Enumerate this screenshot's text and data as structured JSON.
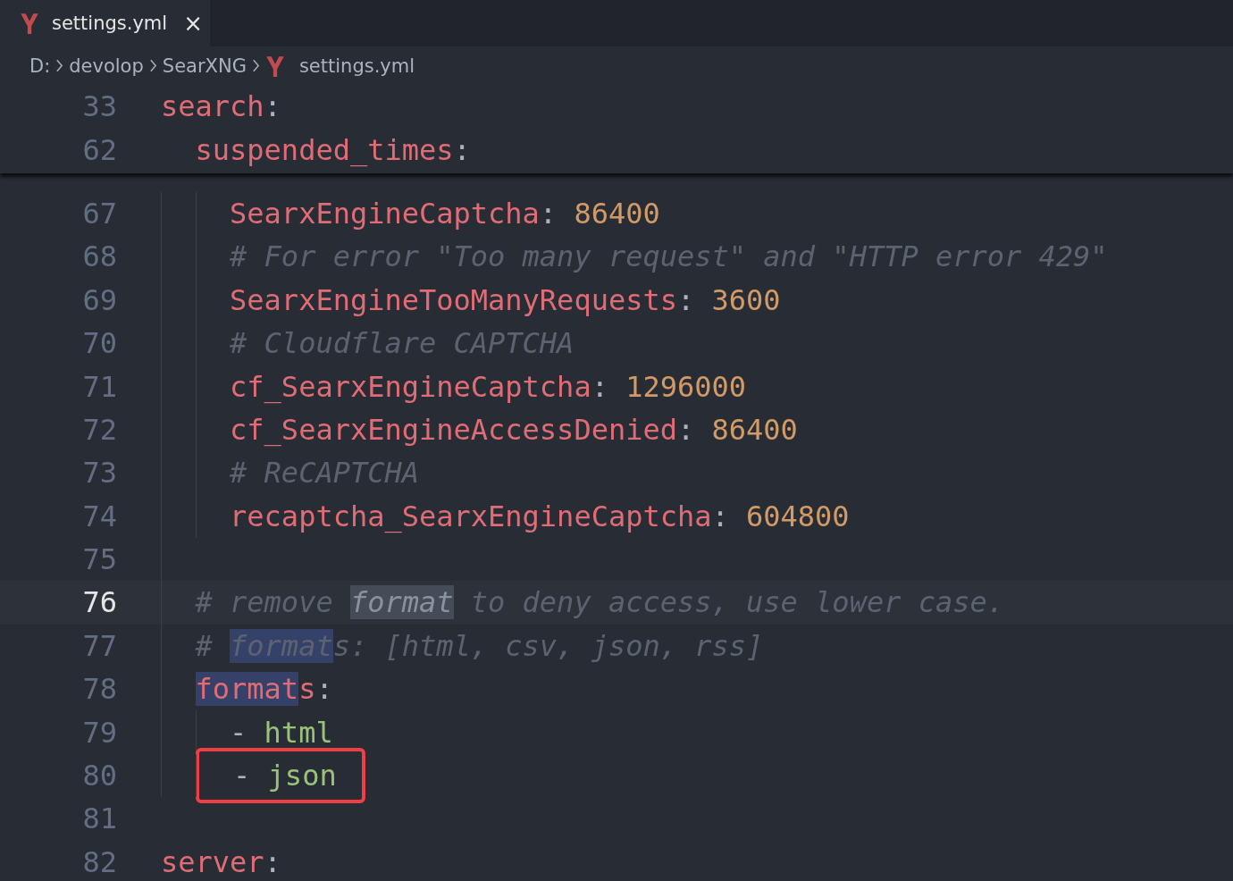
{
  "tab": {
    "label": "settings.yml",
    "close": "×",
    "selected": true
  },
  "breadcrumb": [
    "D:",
    "devolop",
    "SearXNG",
    "settings.yml"
  ],
  "sticky_lines": [
    {
      "number": "33",
      "tokens": [
        {
          "kind": "key",
          "text": "search"
        },
        {
          "kind": "punct",
          "text": ":"
        }
      ]
    },
    {
      "number": "62",
      "tokens": [
        {
          "kind": "key",
          "text": "  suspended_times"
        },
        {
          "kind": "punct",
          "text": ":"
        }
      ]
    }
  ],
  "lines": [
    {
      "number": "67",
      "current": false,
      "boxed": false,
      "tokens": [
        {
          "kind": "key",
          "text": "    SearxEngineCaptcha"
        },
        {
          "kind": "punct",
          "text": ": "
        },
        {
          "kind": "number",
          "text": "86400"
        }
      ]
    },
    {
      "number": "68",
      "current": false,
      "boxed": false,
      "tokens": [
        {
          "kind": "comment",
          "text": "    # For error \"Too many request\" and \"HTTP error 429\""
        }
      ]
    },
    {
      "number": "69",
      "current": false,
      "boxed": false,
      "tokens": [
        {
          "kind": "key",
          "text": "    SearxEngineTooManyRequests"
        },
        {
          "kind": "punct",
          "text": ": "
        },
        {
          "kind": "number",
          "text": "3600"
        }
      ]
    },
    {
      "number": "70",
      "current": false,
      "boxed": false,
      "tokens": [
        {
          "kind": "comment",
          "text": "    # Cloudflare CAPTCHA"
        }
      ]
    },
    {
      "number": "71",
      "current": false,
      "boxed": false,
      "tokens": [
        {
          "kind": "key",
          "text": "    cf_SearxEngineCaptcha"
        },
        {
          "kind": "punct",
          "text": ": "
        },
        {
          "kind": "number",
          "text": "1296000"
        }
      ]
    },
    {
      "number": "72",
      "current": false,
      "boxed": false,
      "tokens": [
        {
          "kind": "key",
          "text": "    cf_SearxEngineAccessDenied"
        },
        {
          "kind": "punct",
          "text": ": "
        },
        {
          "kind": "number",
          "text": "86400"
        }
      ]
    },
    {
      "number": "73",
      "current": false,
      "boxed": false,
      "tokens": [
        {
          "kind": "comment",
          "text": "    # ReCAPTCHA"
        }
      ]
    },
    {
      "number": "74",
      "current": false,
      "boxed": false,
      "tokens": [
        {
          "kind": "key",
          "text": "    recaptcha_SearxEngineCaptcha"
        },
        {
          "kind": "punct",
          "text": ": "
        },
        {
          "kind": "number",
          "text": "604800"
        }
      ]
    },
    {
      "number": "75",
      "current": false
    },
    {
      "number": "76",
      "current": true,
      "boxed": false,
      "tokens": [
        {
          "kind": "comment",
          "text": "  # remove "
        },
        {
          "kind": "comment",
          "text": "format",
          "highlight": true
        },
        {
          "kind": "comment",
          "text": " to deny access, use lower case."
        }
      ]
    },
    {
      "number": "77",
      "current": false,
      "boxed": false,
      "tokens": [
        {
          "kind": "comment",
          "text": "  # "
        },
        {
          "kind": "comment",
          "text": "format",
          "highlight": true
        },
        {
          "kind": "comment",
          "text": "s: [html, csv, json, rss]"
        }
      ]
    },
    {
      "number": "78",
      "current": false,
      "boxed": false,
      "tokens": [
        {
          "kind": "key",
          "text": "  format",
          "highlight": true
        },
        {
          "kind": "key",
          "text": "s"
        },
        {
          "kind": "punct",
          "text": ":"
        }
      ]
    },
    {
      "number": "79",
      "current": false,
      "boxed": false,
      "tokens": [
        {
          "kind": "punct",
          "text": "    - "
        },
        {
          "kind": "string",
          "text": "html"
        }
      ]
    },
    {
      "number": "80",
      "current": false,
      "boxed": true,
      "tokens": [
        {
          "kind": "punct",
          "text": "    - "
        },
        {
          "kind": "string",
          "text": "json"
        }
      ]
    },
    {
      "number": "81",
      "current": false
    },
    {
      "number": "82",
      "current": false,
      "boxed": false,
      "tokens": [
        {
          "kind": "key",
          "text": "server"
        },
        {
          "kind": "punct",
          "text": ":"
        }
      ]
    }
  ]
}
